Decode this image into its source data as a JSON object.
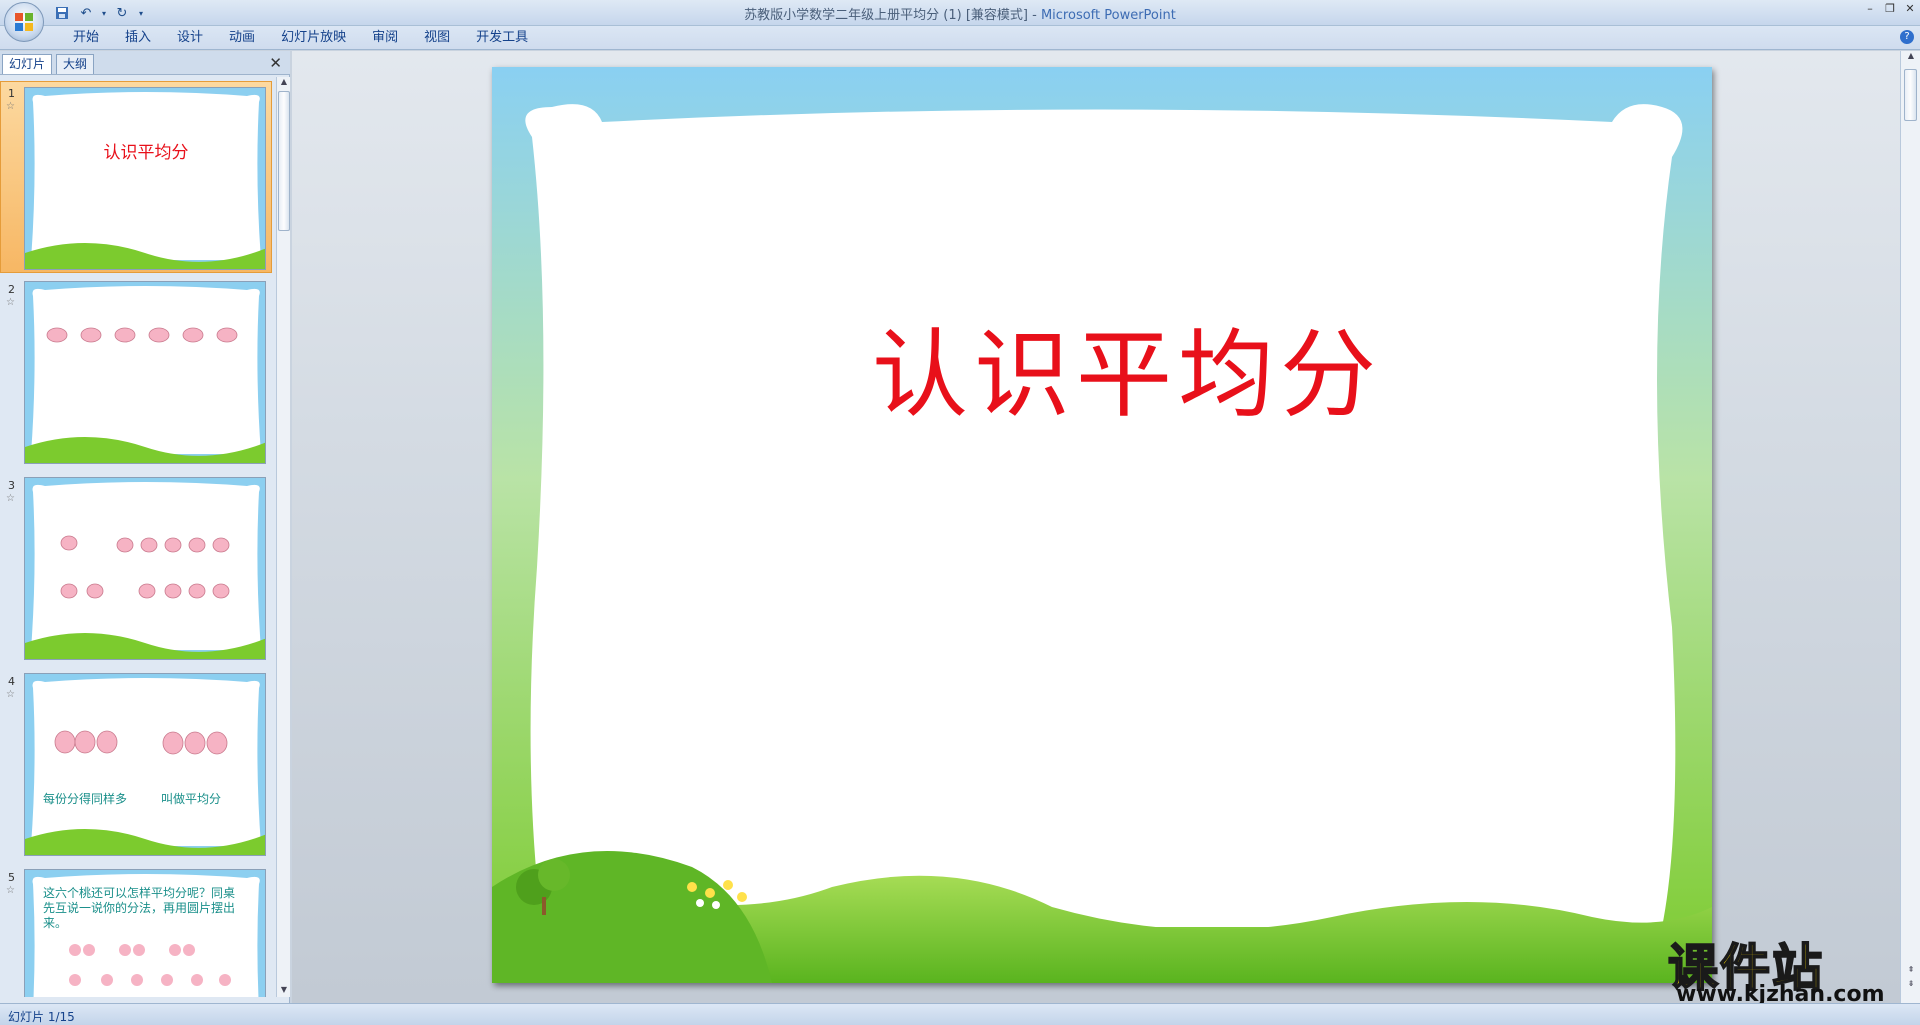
{
  "window": {
    "title": "苏教版小学数学二年级上册平均分 (1) [兼容模式] - ",
    "app_name": "Microsoft PowerPoint"
  },
  "ribbon": {
    "tabs": [
      "开始",
      "插入",
      "设计",
      "动画",
      "幻灯片放映",
      "审阅",
      "视图",
      "开发工具"
    ]
  },
  "left_panel": {
    "tabs": [
      "幻灯片",
      "大纲"
    ],
    "active_tab": 0,
    "thumbnails": [
      {
        "number": "1",
        "title": "认识平均分",
        "selected": true
      },
      {
        "number": "2",
        "peaches_row": 6
      },
      {
        "number": "3"
      },
      {
        "number": "4",
        "caption_left": "每份分得同样多",
        "caption_right": "叫做平均分"
      },
      {
        "number": "5",
        "text": "这六个桃还可以怎样平均分呢？同桌先互说一说你的分法，再用圆片摆出来。"
      }
    ]
  },
  "slide": {
    "title": "认识平均分",
    "title_color": "#e8101a"
  },
  "status": {
    "slide_counter": "幻灯片 1/15"
  },
  "watermark": {
    "cn": "课件站",
    "url": "www.kjzhan.com"
  },
  "colors": {
    "sky": "#8ccff0",
    "grass": "#7ccb2e",
    "accent_selected": "#f7b764"
  }
}
